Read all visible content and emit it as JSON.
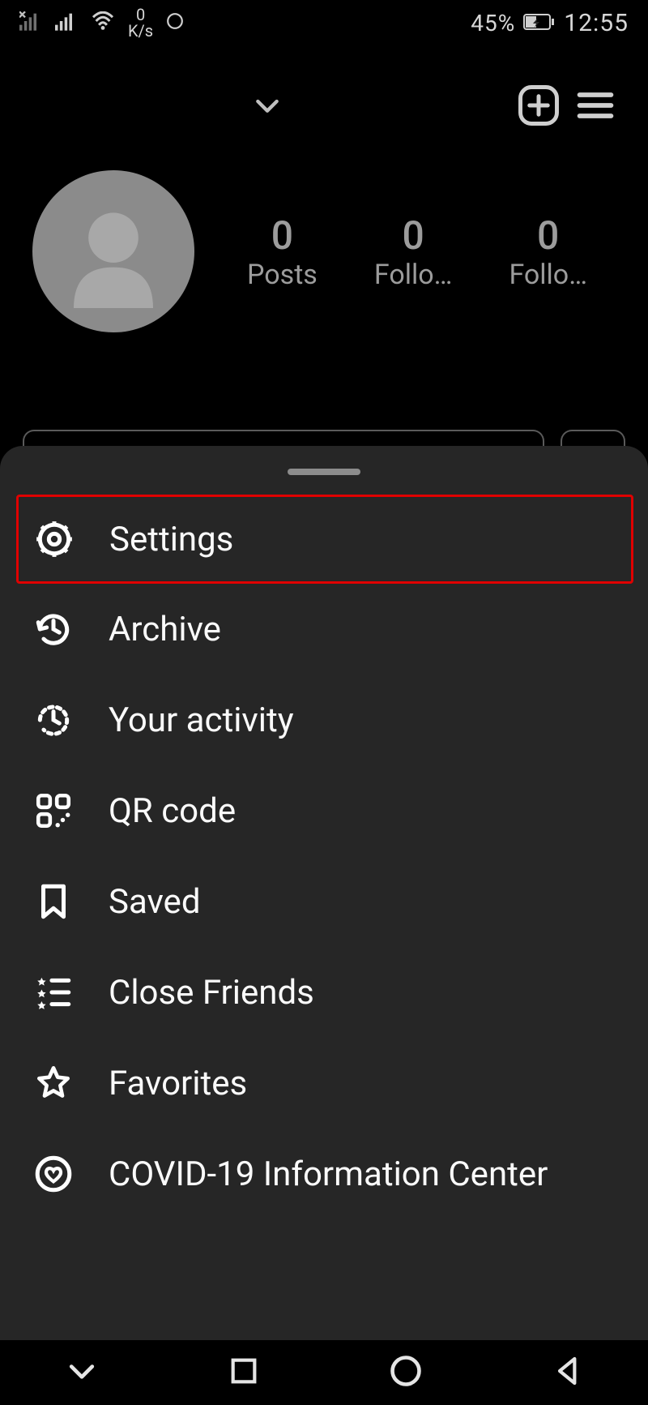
{
  "status_bar": {
    "data_speed_top": "0",
    "data_speed_unit": "K/s",
    "battery_pct": "45%",
    "clock": "12:55"
  },
  "profile": {
    "stats": [
      {
        "count": "0",
        "label": "Posts"
      },
      {
        "count": "0",
        "label": "Follo…"
      },
      {
        "count": "0",
        "label": "Follo…"
      }
    ]
  },
  "menu": [
    {
      "id": "settings",
      "label": "Settings"
    },
    {
      "id": "archive",
      "label": "Archive"
    },
    {
      "id": "your-activity",
      "label": "Your activity"
    },
    {
      "id": "qr-code",
      "label": "QR code"
    },
    {
      "id": "saved",
      "label": "Saved"
    },
    {
      "id": "close-friends",
      "label": "Close Friends"
    },
    {
      "id": "favorites",
      "label": "Favorites"
    },
    {
      "id": "covid",
      "label": "COVID-19 Information Center"
    }
  ]
}
